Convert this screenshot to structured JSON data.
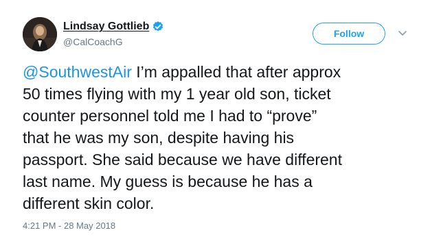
{
  "author": {
    "display_name": "Lindsay Gottlieb",
    "handle": "@CalCoachG",
    "verified_icon": "verified-badge-icon",
    "avatar_icon": "profile-photo"
  },
  "actions": {
    "follow_label": "Follow",
    "more_icon": "chevron-down-icon"
  },
  "tweet": {
    "mention": "@SouthwestAir",
    "text_lines": [
      " I’m appalled that after approx",
      "50 times flying with my 1 year old son, ticket",
      "counter personnel told me I had to “prove”",
      "that he was my son, despite having his",
      "passport. She said because we have different",
      "last name. My guess is because he has a",
      "different skin color."
    ],
    "timestamp": "4:21 PM - 28 May 2018"
  },
  "colors": {
    "accent": "#1da1f2",
    "mention": "#1b95e0",
    "text": "#14171a",
    "secondary": "#657786"
  }
}
